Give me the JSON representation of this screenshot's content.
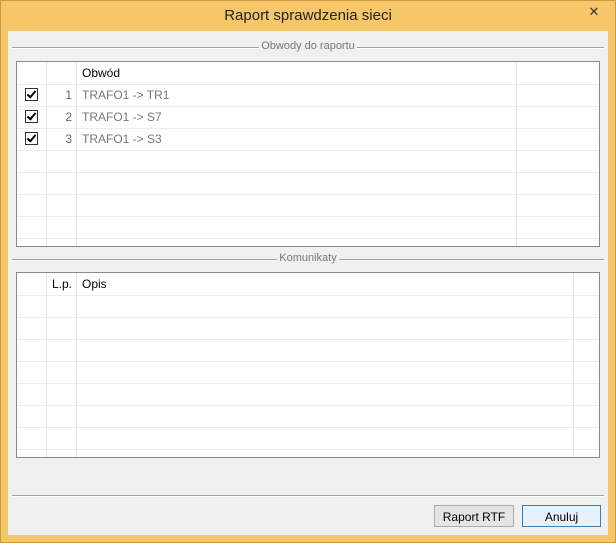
{
  "window": {
    "title": "Raport sprawdzenia sieci",
    "close_glyph": "✕"
  },
  "circuits_group": {
    "label": "Obwody do raportu",
    "columns": [
      "",
      "",
      "Obwód",
      ""
    ],
    "rows": [
      {
        "checked": true,
        "index": "1",
        "name": "TRAFO1 -> TR1"
      },
      {
        "checked": true,
        "index": "2",
        "name": "TRAFO1 -> S7"
      },
      {
        "checked": true,
        "index": "3",
        "name": "TRAFO1 -> S3"
      }
    ]
  },
  "messages_group": {
    "label": "Komunikaty",
    "columns": [
      "",
      "L.p.",
      "Opis",
      ""
    ],
    "rows": []
  },
  "buttons": {
    "report_rtf": "Raport RTF",
    "cancel": "Anuluj"
  },
  "icons": {
    "close": "close-icon",
    "checkbox": "checkbox-checked-icon"
  }
}
